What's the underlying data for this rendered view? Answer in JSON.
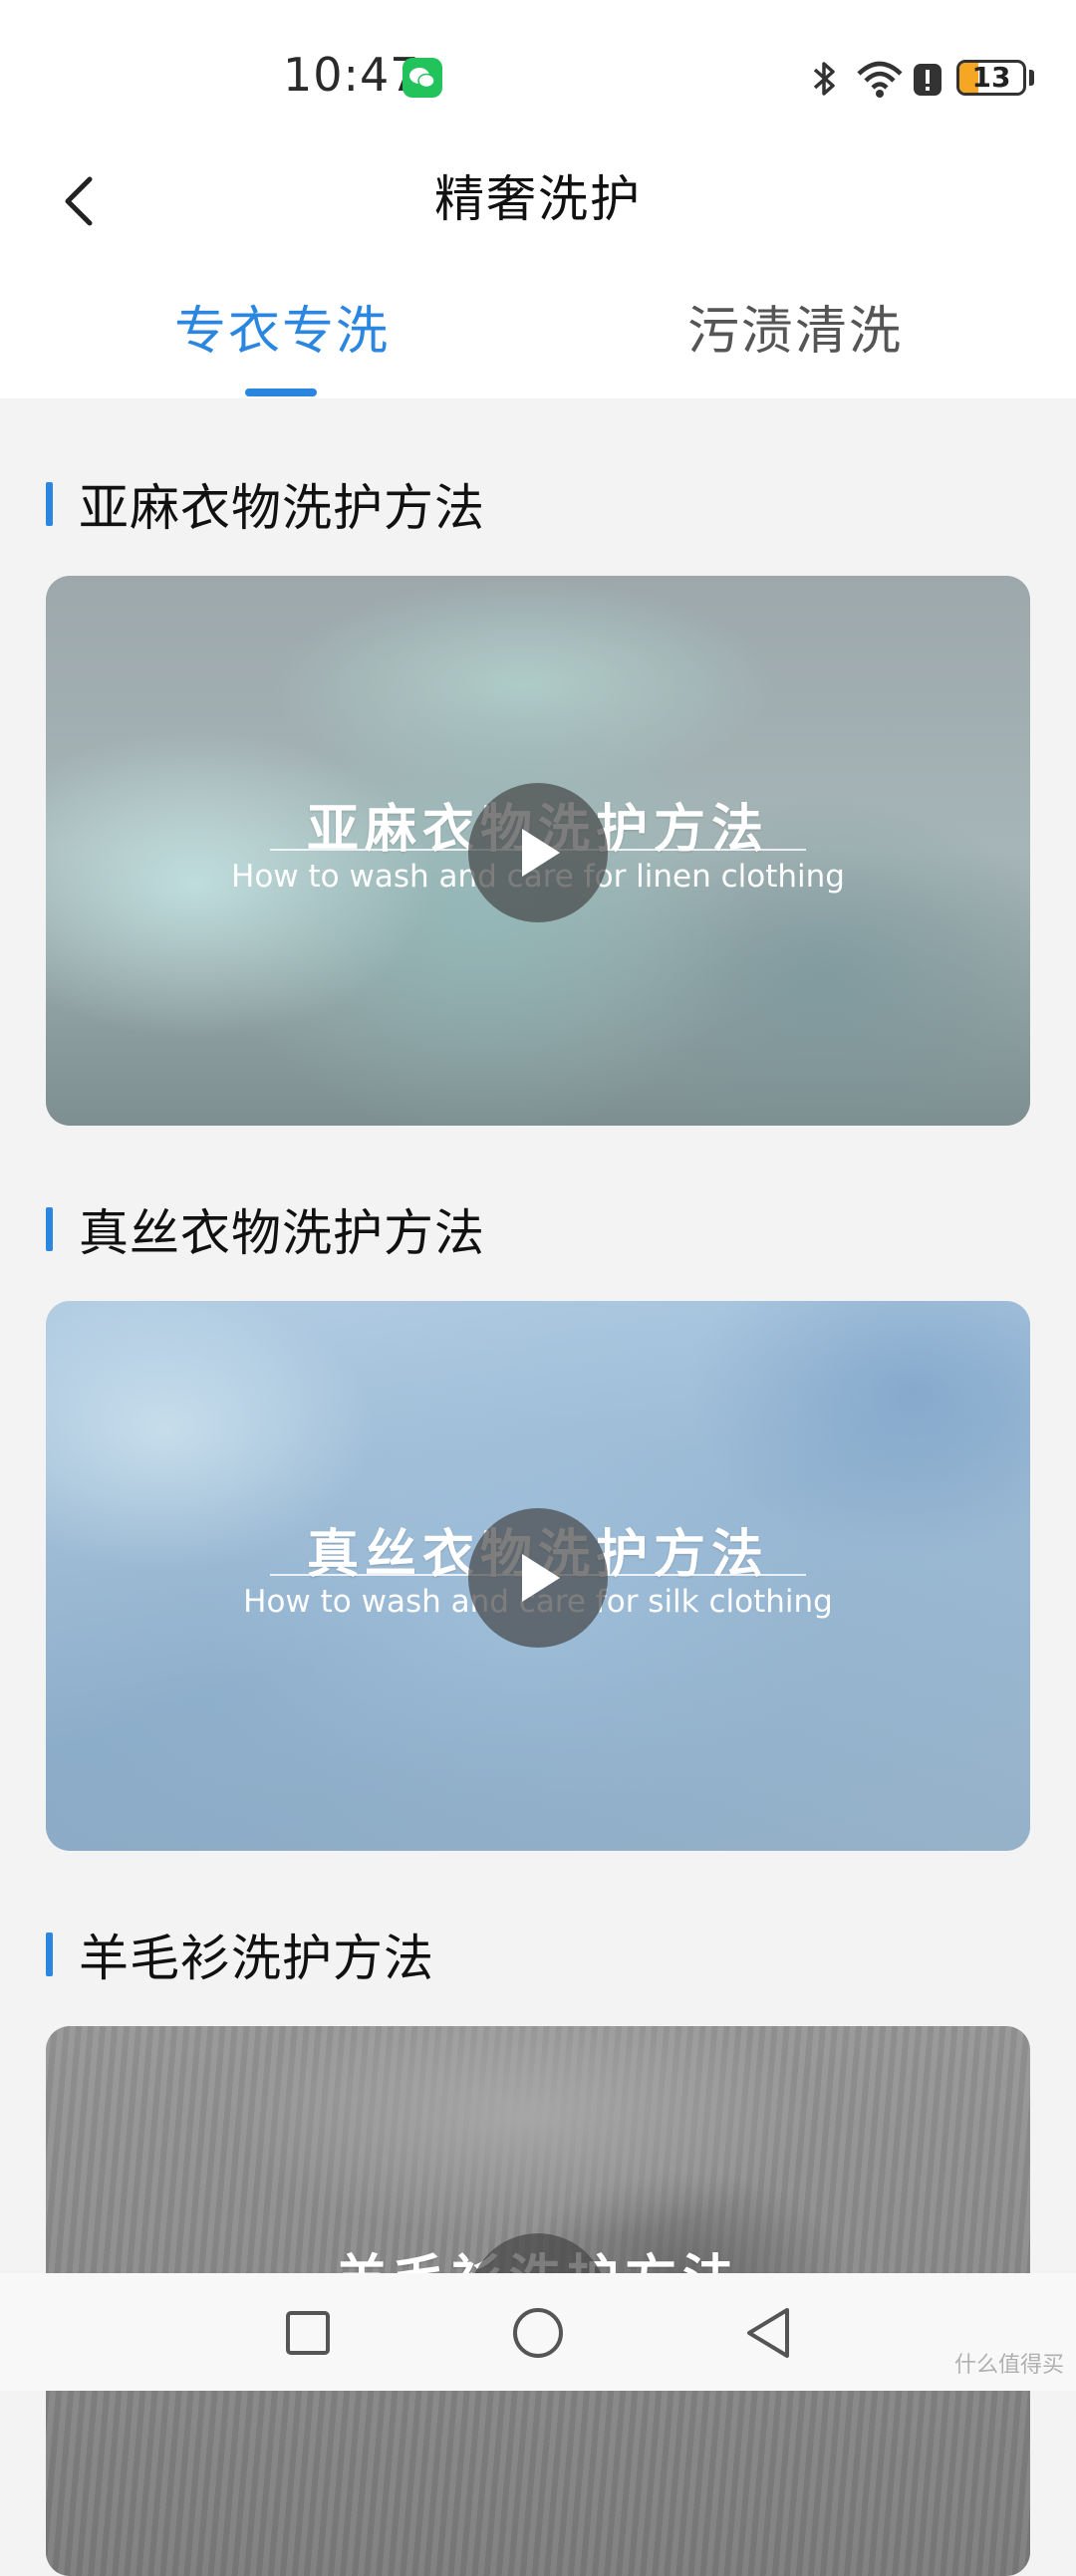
{
  "status_bar": {
    "time": "10:47",
    "battery_level": "13",
    "battery_color": "#f5a623",
    "icons": [
      "wechat-icon",
      "bluetooth-icon",
      "wifi-icon",
      "alert-icon",
      "battery-icon"
    ]
  },
  "header": {
    "title": "精奢洗护",
    "back_icon": "chevron-left-icon"
  },
  "tabs": [
    {
      "label": "专衣专洗",
      "active": true
    },
    {
      "label": "污渍清洗",
      "active": false
    }
  ],
  "accent_color": "#2b86e0",
  "sections": [
    {
      "title": "亚麻衣物洗护方法",
      "video_title_cn": "亚麻衣物洗护方法",
      "video_title_en": "How to wash and care for linen clothing"
    },
    {
      "title": "真丝衣物洗护方法",
      "video_title_cn": "真丝衣物洗护方法",
      "video_title_en": "How to wash and care for silk clothing"
    },
    {
      "title": "羊毛衫洗护方法",
      "video_title_cn": "羊毛衫洗护方法",
      "video_title_en": ""
    }
  ],
  "system_nav": [
    "recent-apps-icon",
    "home-icon",
    "back-triangle-icon"
  ],
  "watermark": "什么值得买"
}
